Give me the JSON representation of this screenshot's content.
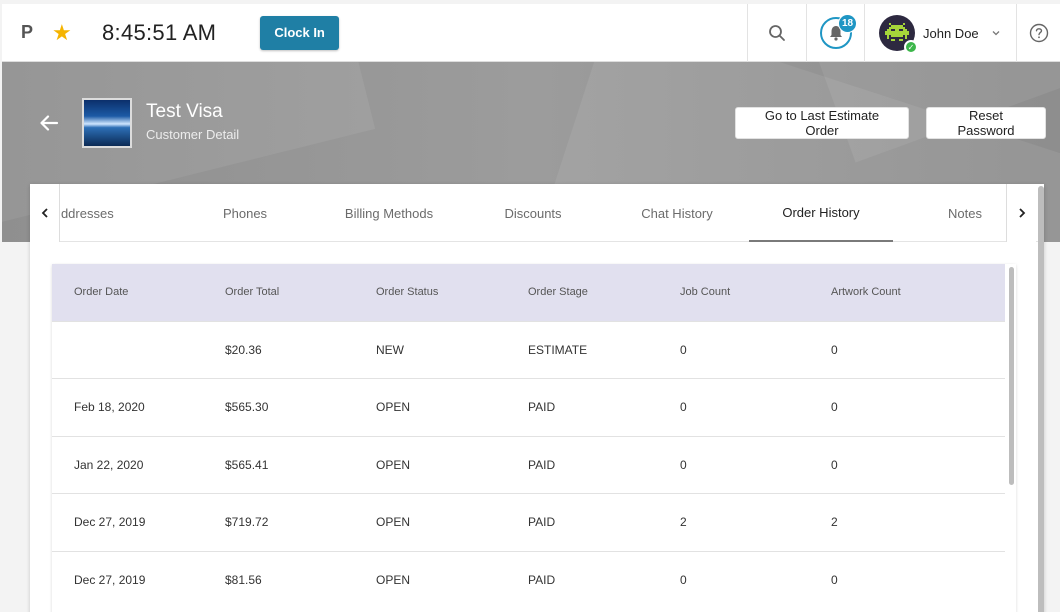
{
  "topbar": {
    "brand_letter": "P",
    "time": "8:45:51 AM",
    "clock_in_label": "Clock In",
    "notification_count": "18",
    "user_name": "John Doe"
  },
  "header": {
    "customer_name": "Test Visa",
    "subtitle": "Customer Detail",
    "last_estimate_label": "Go to Last Estimate Order",
    "reset_password_label": "Reset Password"
  },
  "tabs": [
    "Addresses",
    "Phones",
    "Billing Methods",
    "Discounts",
    "Chat History",
    "Order History",
    "Notes"
  ],
  "active_tab": "Order History",
  "table": {
    "columns": [
      "Order Date",
      "Order Total",
      "Order Status",
      "Order Stage",
      "Job Count",
      "Artwork Count"
    ],
    "rows": [
      [
        "",
        "$20.36",
        "NEW",
        "ESTIMATE",
        "0",
        "0"
      ],
      [
        "Feb 18, 2020",
        "$565.30",
        "OPEN",
        "PAID",
        "0",
        "0"
      ],
      [
        "Jan 22, 2020",
        "$565.41",
        "OPEN",
        "PAID",
        "0",
        "0"
      ],
      [
        "Dec 27, 2019",
        "$719.72",
        "OPEN",
        "PAID",
        "2",
        "2"
      ],
      [
        "Dec 27, 2019",
        "$81.56",
        "OPEN",
        "PAID",
        "0",
        "0"
      ]
    ]
  },
  "colors": {
    "accent": "#1f7fa5",
    "badge": "#1f96c4",
    "header_row": "#e1e0ef",
    "star": "#f5b400"
  }
}
